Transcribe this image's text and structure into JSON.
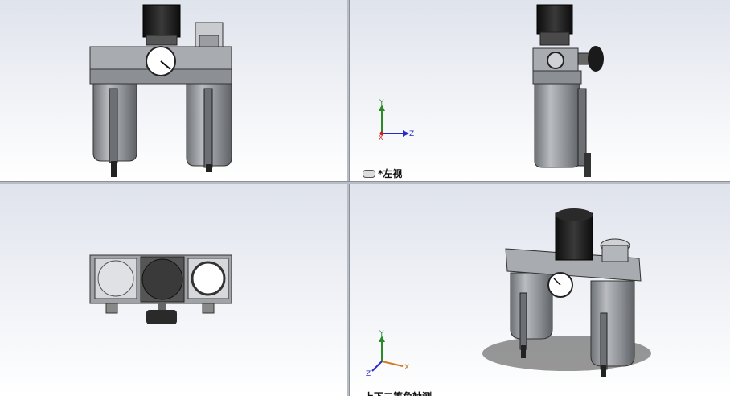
{
  "viewports": {
    "front": {
      "label": ""
    },
    "left": {
      "label": "*左视"
    },
    "top": {
      "label": ""
    },
    "iso": {
      "label": "上下二等角轴测"
    }
  },
  "triads": {
    "left": {
      "up": "Y",
      "right": "Z",
      "origin": "X"
    },
    "iso": {
      "up": "Y",
      "right": "X",
      "left": "Z"
    }
  },
  "colors": {
    "viewport_top": "#dfe3ec",
    "viewport_bottom": "#ffffff",
    "part_body": "#8a8d91",
    "part_dark": "#1c1c1c",
    "axis_y": "#2a8a2a",
    "axis_z": "#2a2acc",
    "axis_x": "#d07a20"
  }
}
